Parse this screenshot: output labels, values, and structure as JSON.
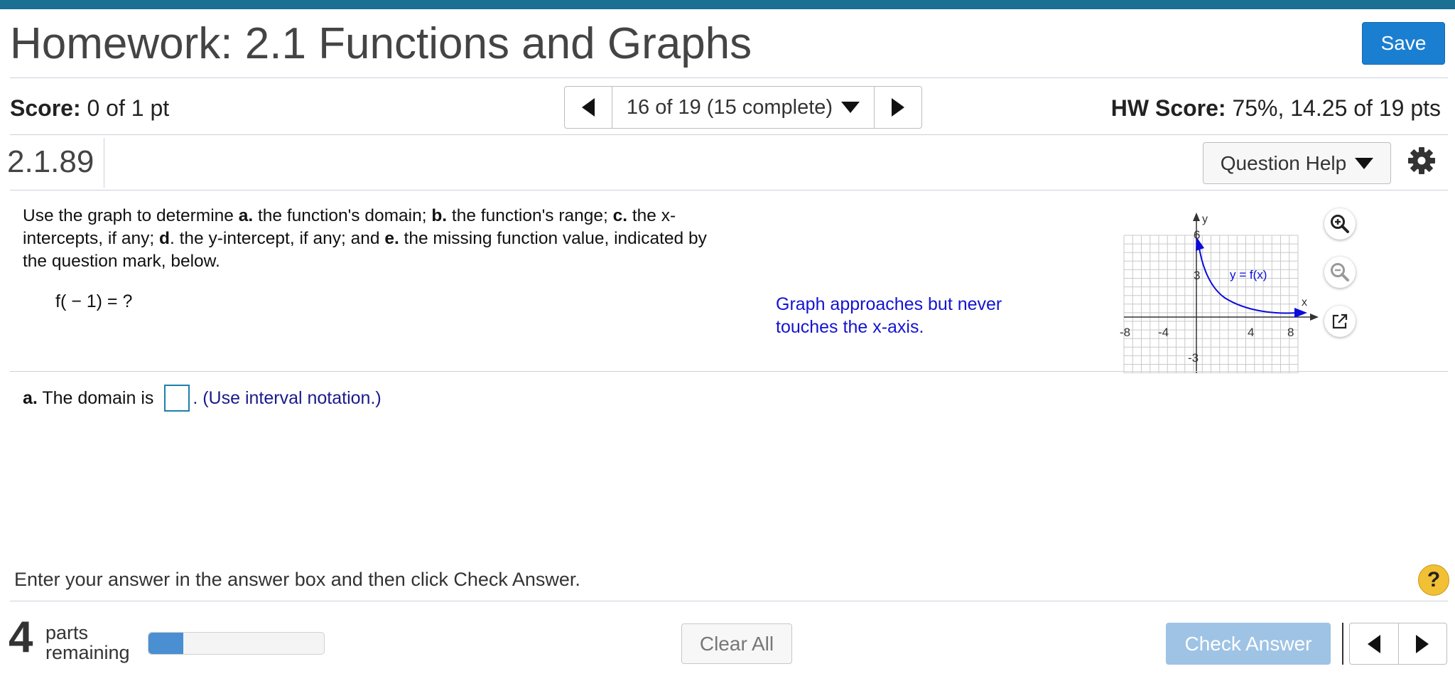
{
  "header": {
    "title": "Homework: 2.1 Functions and Graphs",
    "save_label": "Save"
  },
  "score_bar": {
    "score_label": "Score:",
    "score_value": "0 of 1 pt",
    "nav_position": "16 of 19 (15 complete)",
    "hw_score_label": "HW Score:",
    "hw_score_value": "75%, 14.25 of 19 pts"
  },
  "question": {
    "number": "2.1.89",
    "help_label": "Question Help",
    "text_parts": [
      "Use the graph to determine ",
      "a.",
      " the function's domain; ",
      "b.",
      " the function's range; ",
      "c.",
      " the x-intercepts, if any; ",
      "d",
      ". the y-intercept, if any; and ",
      "e.",
      " the missing function value, indicated by the question mark, below."
    ],
    "function_value": "f( − 1) = ?",
    "graph_note": "Graph approaches but never touches the x-axis.",
    "part_a_label": "a.",
    "part_a_text": " The domain is ",
    "part_a_hint": ". (Use interval notation.)"
  },
  "graph": {
    "function_label": "y = f(x)",
    "x_axis_label": "x",
    "y_axis_label": "y",
    "x_ticks": [
      "-8",
      "-4",
      "4",
      "8"
    ],
    "y_ticks": [
      "6",
      "3",
      "-3"
    ],
    "curve_color": "#0b0bdc"
  },
  "footer": {
    "instruction": "Enter your answer in the answer box and then click Check Answer.",
    "parts_count": "4",
    "parts_line1": "parts",
    "parts_line2": "remaining",
    "progress_fraction": 0.2,
    "clear_all_label": "Clear All",
    "check_answer_label": "Check Answer",
    "help_symbol": "?"
  },
  "colors": {
    "accent": "#1b7fd1",
    "top_bar": "#1a6f93",
    "note_text": "#1414d2",
    "check_disabled": "#9ec3e4"
  }
}
